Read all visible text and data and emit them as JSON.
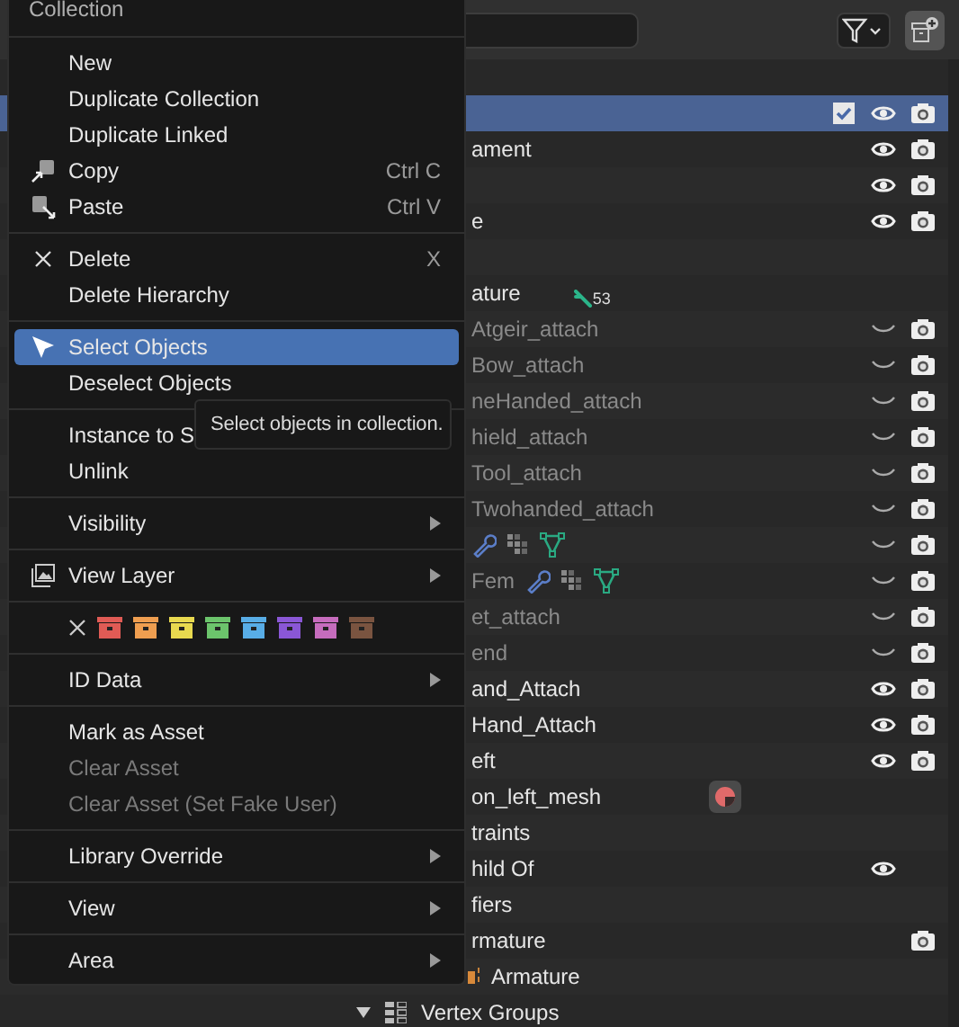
{
  "outliner": {
    "rows": [
      {
        "kind": "item",
        "selected": false,
        "renderable": false
      },
      {
        "kind": "item",
        "selected": true,
        "checked": true,
        "visible": true,
        "renderable": true
      },
      {
        "kind": "item",
        "label": "ament",
        "selected": false,
        "dimmed": false,
        "visible": true,
        "renderable": true
      },
      {
        "kind": "item",
        "selected": false,
        "visible": true,
        "renderable": true
      },
      {
        "kind": "item",
        "label": "e",
        "selected": false,
        "dimmed": false,
        "visible": true,
        "renderable": true
      },
      {
        "kind": "item",
        "selected": false,
        "renderable": false
      },
      {
        "kind": "item",
        "label": "ature",
        "selected": false,
        "dimmed": false,
        "renderable": false,
        "badges": [
          {
            "kind": "bone",
            "count": "53"
          }
        ]
      },
      {
        "kind": "item",
        "label": "Atgeir_attach",
        "selected": false,
        "dimmed": true,
        "visible": false,
        "renderable": true
      },
      {
        "kind": "item",
        "label": "Bow_attach",
        "selected": false,
        "dimmed": true,
        "visible": false,
        "renderable": true
      },
      {
        "kind": "item",
        "label": "neHanded_attach",
        "selected": false,
        "dimmed": true,
        "visible": false,
        "renderable": true
      },
      {
        "kind": "item",
        "label": "hield_attach",
        "selected": false,
        "dimmed": true,
        "visible": false,
        "renderable": true
      },
      {
        "kind": "item",
        "label": "Tool_attach",
        "selected": false,
        "dimmed": true,
        "visible": false,
        "renderable": true
      },
      {
        "kind": "item",
        "label": "Twohanded_attach",
        "selected": false,
        "dimmed": true,
        "visible": false,
        "renderable": true
      },
      {
        "kind": "item",
        "selected": false,
        "visible": false,
        "renderable": true,
        "badges": [
          {
            "kind": "wrench"
          },
          {
            "kind": "grid"
          },
          {
            "kind": "mesh"
          }
        ]
      },
      {
        "kind": "item",
        "label": "Fem",
        "selected": false,
        "dimmed": true,
        "visible": false,
        "renderable": true,
        "badges": [
          {
            "kind": "wrench"
          },
          {
            "kind": "grid"
          },
          {
            "kind": "mesh"
          }
        ]
      },
      {
        "kind": "item",
        "label": "et_attach",
        "selected": false,
        "dimmed": true,
        "visible": false,
        "renderable": true
      },
      {
        "kind": "item",
        "label": "end",
        "selected": false,
        "dimmed": true,
        "visible": false,
        "renderable": true
      },
      {
        "kind": "item",
        "label": "and_Attach",
        "selected": false,
        "dimmed": false,
        "visible": true,
        "renderable": true
      },
      {
        "kind": "item",
        "label": "Hand_Attach",
        "selected": false,
        "dimmed": false,
        "visible": true,
        "renderable": true
      },
      {
        "kind": "item",
        "label": "eft",
        "selected": false,
        "dimmed": false,
        "visible": true,
        "renderable": true
      },
      {
        "kind": "item",
        "label": "on_left_mesh",
        "selected": false,
        "dimmed": false,
        "renderable": false,
        "badges": [
          {
            "kind": "material"
          }
        ]
      },
      {
        "kind": "item",
        "label": "traints",
        "selected": false,
        "dimmed": false,
        "renderable": false
      },
      {
        "kind": "item",
        "label": "hild Of",
        "selected": false,
        "dimmed": false,
        "visible": true,
        "renderable": false
      },
      {
        "kind": "item",
        "label": "fiers",
        "selected": false,
        "dimmed": false,
        "renderable": false
      },
      {
        "kind": "item",
        "label": "rmature",
        "selected": false,
        "dimmed": false,
        "renderable": true
      },
      {
        "kind": "sub",
        "label": "Armature",
        "selected": false,
        "dimmed": false,
        "renderable": false,
        "lead": {
          "kind": "armature"
        }
      },
      {
        "kind": "group",
        "label": "Vertex Groups",
        "selected": false,
        "dimmed": false,
        "renderable": false,
        "lead": {
          "kind": "grid"
        },
        "expanded": true
      }
    ]
  },
  "menu": {
    "title": "Collection",
    "groups": [
      {
        "items": [
          {
            "kind": "plain",
            "label": "New",
            "selected": false,
            "disabled": false,
            "submenu": false
          },
          {
            "kind": "plain",
            "label": "Duplicate Collection",
            "selected": false,
            "disabled": false,
            "submenu": false
          },
          {
            "kind": "plain",
            "label": "Duplicate Linked",
            "selected": false,
            "disabled": false,
            "submenu": false
          },
          {
            "kind": "copy",
            "label": "Copy",
            "shortcut": "Ctrl C",
            "selected": false,
            "disabled": false,
            "submenu": false
          },
          {
            "kind": "paste",
            "label": "Paste",
            "shortcut": "Ctrl V",
            "selected": false,
            "disabled": false,
            "submenu": false
          }
        ]
      },
      {
        "items": [
          {
            "kind": "delete",
            "label": "Delete",
            "shortcut": "X",
            "selected": false,
            "disabled": false,
            "submenu": false
          },
          {
            "kind": "plain",
            "label": "Delete Hierarchy",
            "selected": false,
            "disabled": false,
            "submenu": false
          }
        ]
      },
      {
        "items": [
          {
            "kind": "select",
            "label": "Select Objects",
            "selected": true,
            "disabled": false,
            "submenu": false
          },
          {
            "kind": "plain",
            "label": "Deselect Objects",
            "selected": false,
            "disabled": false,
            "submenu": false
          }
        ]
      },
      {
        "items": [
          {
            "kind": "plain",
            "label": "Instance to S",
            "selected": false,
            "disabled": false
          },
          {
            "kind": "plain",
            "label": "Unlink",
            "selected": false,
            "disabled": false,
            "submenu": false
          }
        ]
      },
      {
        "items": [
          {
            "kind": "plain",
            "label": "Visibility",
            "selected": false,
            "disabled": false,
            "submenu": true
          }
        ]
      },
      {
        "items": [
          {
            "kind": "layer",
            "label": "View Layer",
            "selected": false,
            "disabled": false,
            "submenu": true
          }
        ]
      },
      {
        "items": [
          {
            "kind": "colors",
            "colors": [
              {
                "color": "#e05b55"
              },
              {
                "color": "#ef9e50"
              },
              {
                "color": "#e8d94f"
              },
              {
                "color": "#6cc46c"
              },
              {
                "color": "#58ade6"
              },
              {
                "color": "#8a57d6"
              },
              {
                "color": "#c66cbd"
              },
              {
                "color": "#7a5440"
              }
            ]
          }
        ]
      },
      {
        "items": [
          {
            "kind": "plain",
            "label": "ID Data",
            "selected": false,
            "disabled": false,
            "submenu": true
          }
        ]
      },
      {
        "items": [
          {
            "kind": "plain",
            "label": "Mark as Asset",
            "selected": false,
            "disabled": false,
            "submenu": false
          },
          {
            "kind": "plain",
            "label": "Clear Asset",
            "selected": false,
            "disabled": true,
            "submenu": false
          },
          {
            "kind": "plain",
            "label": "Clear Asset (Set Fake User)",
            "selected": false,
            "disabled": true,
            "submenu": false
          }
        ]
      },
      {
        "items": [
          {
            "kind": "plain",
            "label": "Library Override",
            "selected": false,
            "disabled": false,
            "submenu": true
          }
        ]
      },
      {
        "items": [
          {
            "kind": "plain",
            "label": "View",
            "selected": false,
            "disabled": false,
            "submenu": true
          }
        ]
      },
      {
        "items": [
          {
            "kind": "plain",
            "label": "Area",
            "selected": false,
            "disabled": false,
            "submenu": true
          }
        ]
      }
    ]
  },
  "tooltip": {
    "text": "Select objects in collection."
  }
}
